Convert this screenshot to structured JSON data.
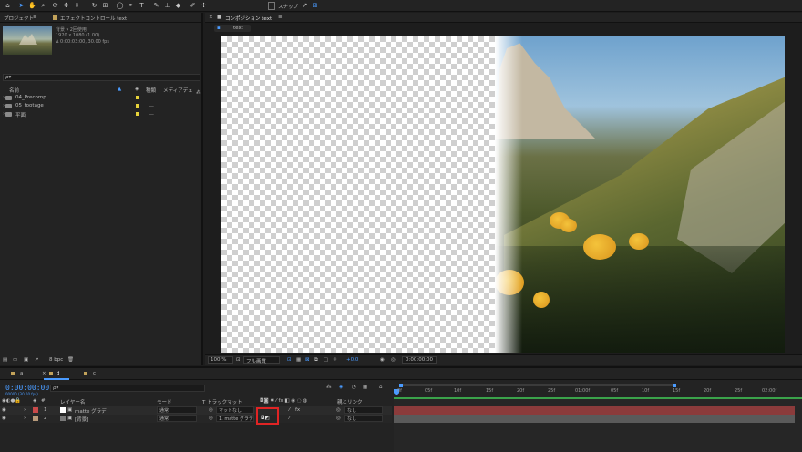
{
  "project_panel": {
    "tab_project": "プロジェクト",
    "tab_effect_controls": "エフェクトコントロール text",
    "meta_line1": "背景 ▾ 2回使用",
    "meta_line2": "1920 x 1080 (1.00)",
    "meta_line3": "Δ 0:00:03:00, 30.00 fps",
    "search_placeholder": "ρ▾",
    "col_name": "名前",
    "col_type": "種類",
    "col_media": "メディアデュ",
    "items": [
      {
        "label": "04_Precomp"
      },
      {
        "label": "05_footage"
      },
      {
        "label": "平面"
      }
    ],
    "bpc": "8 bpc"
  },
  "comp_panel": {
    "tab_label": "コンポジション text",
    "breadcrumb": "text",
    "zoom": "100 %",
    "resolution": "フル画質",
    "exposure": "+0.0",
    "timecode": "0:00:00:00"
  },
  "timeline": {
    "tab1": "a",
    "tab2": "d",
    "tab3": "c",
    "timecode": "0:00:00:00",
    "timecode_sub": "00000 (30.00 fps)",
    "search_placeholder": "ρ▾",
    "col_layer_name": "レイヤー名",
    "col_mode": "モード",
    "col_trackmatte": "T トラックマット",
    "col_parent": "親とリンク",
    "ruler": [
      "0f",
      "05f",
      "10f",
      "15f",
      "20f",
      "25f",
      "01:00f",
      "05f",
      "10f",
      "15f",
      "20f",
      "25f",
      "02:00f"
    ],
    "layers": [
      {
        "num": "1",
        "name": "matte グラデ",
        "mode": "通常",
        "matte": "マットなし",
        "parent": "なし",
        "color": "#c94a4a"
      },
      {
        "num": "2",
        "name": "[背景]",
        "mode": "通常",
        "matte": "1. matte グラデ",
        "parent": "なし",
        "color": "#b89a7a"
      }
    ]
  },
  "toolbar": {
    "snapping": "スナップ"
  },
  "colors": {
    "accent": "#4a9bff",
    "highlight": "#e02424",
    "layer1": "#c94a4a",
    "layer2": "#b89a7a"
  }
}
